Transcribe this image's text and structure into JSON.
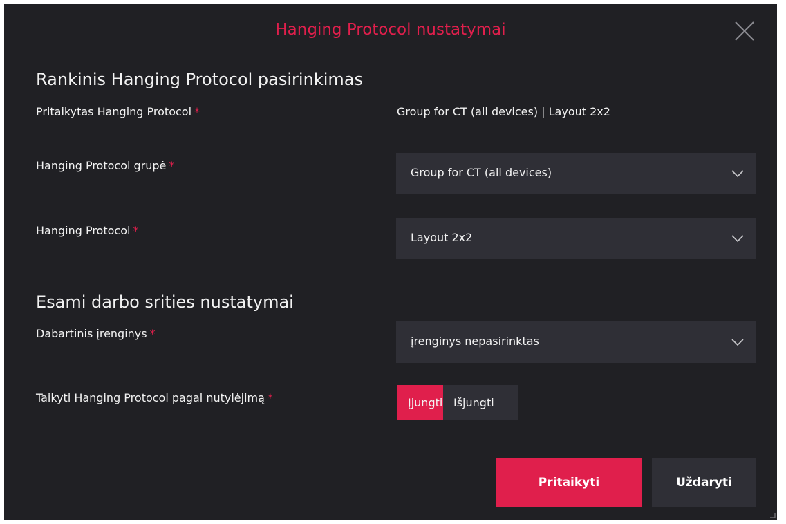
{
  "dialog": {
    "title": "Hanging Protocol nustatymai",
    "close_icon": "close-icon",
    "accent_color": "#e01f4c",
    "background_color": "#202024",
    "control_color": "#2f2f36"
  },
  "manual_section": {
    "title": "Rankinis Hanging Protocol pasirinkimas",
    "applied": {
      "label": "Pritaikytas Hanging Protocol",
      "required_mark": "*",
      "value": "Group for CT (all devices) | Layout 2x2"
    },
    "group": {
      "label": "Hanging Protocol grupė",
      "required_mark": "*",
      "selected": "Group for CT (all devices)"
    },
    "protocol": {
      "label": "Hanging Protocol",
      "required_mark": "*",
      "selected": "Layout 2x2"
    }
  },
  "workspace_section": {
    "title": "Esami darbo srities nustatymai",
    "device": {
      "label": "Dabartinis įrenginys",
      "required_mark": "*",
      "selected": "įrenginys nepasirinktas"
    },
    "default_apply": {
      "label": "Taikyti Hanging Protocol pagal nutylėjimą",
      "required_mark": "*",
      "on_label": "Įjungti",
      "off_label": "Išjungti",
      "active": "on"
    }
  },
  "footer": {
    "apply_label": "Pritaikyti",
    "close_label": "Uždaryti"
  }
}
